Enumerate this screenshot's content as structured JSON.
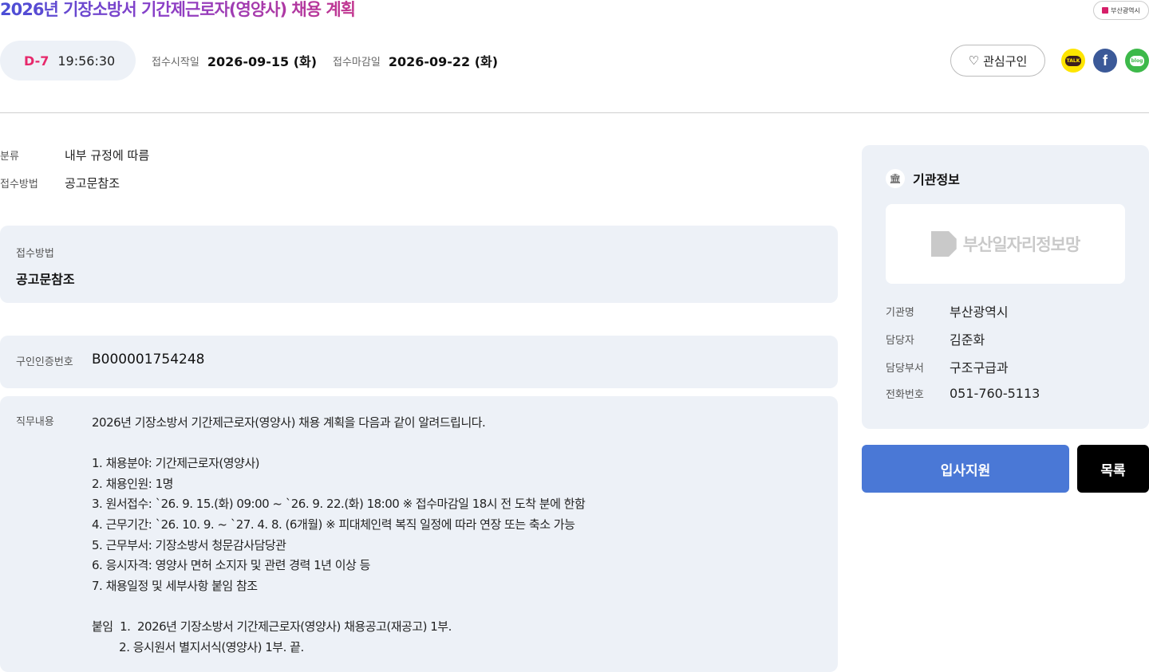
{
  "header": {
    "title": "2026년 기장소방서 기간제근로자(영양사) 채용 계획",
    "org_badge": "부산광역시",
    "dday": "D-7",
    "countdown": "19:56:30",
    "start_label": "접수시작일",
    "start_value": "2026-09-15 (화)",
    "end_label": "접수마감일",
    "end_value": "2026-09-22 (화)",
    "favorite_label": "관심구인",
    "share": {
      "kakao": "TALK",
      "facebook": "f",
      "blog": "blog"
    }
  },
  "summary": [
    {
      "label": "분류",
      "value": "내부 규정에 따름"
    },
    {
      "label": "접수방법",
      "value": "공고문참조"
    }
  ],
  "method_box": {
    "label": "접수방법",
    "value": "공고문참조"
  },
  "cert_box": {
    "label": "구인인증번호",
    "value": "B000001754248"
  },
  "job_box": {
    "label": "직무내용",
    "lines": [
      "2026년 기장소방서 기간제근로자(영양사) 채용 계획을 다음과 같이 알려드립니다.",
      "",
      "1. 채용분야: 기간제근로자(영양사)",
      "2. 채용인원: 1명",
      "3. 원서접수: `26. 9. 15.(화) 09:00 ~ `26. 9. 22.(화) 18:00 ※ 접수마감일 18시 전 도착 분에 한함",
      "4. 근무기간: `26. 10. 9. ~ `27. 4. 8. (6개월) ※ 피대체인력 복직 일정에 따라 연장 또는 축소 가능",
      "5. 근무부서: 기장소방서 청문감사담당관",
      "6. 응시자격: 영양사 면허 소지자 및 관련 경력 1년 이상 등",
      "7. 채용일정 및 세부사항 붙임 참조",
      "",
      "붙임  1.  2026년 기장소방서 기간제근로자(영양사) 채용공고(재공고) 1부.",
      "        2. 응시원서 별지서식(영양사) 1부. 끝."
    ]
  },
  "sidebar": {
    "title": "기관정보",
    "logo_text": "부산일자리정보망",
    "rows": [
      {
        "label": "기관명",
        "value": "부산광역시"
      },
      {
        "label": "담당자",
        "value": "김준화"
      },
      {
        "label": "담당부서",
        "value": "구조구급과"
      },
      {
        "label": "전화번호",
        "value": "051-760-5113"
      }
    ]
  },
  "actions": {
    "apply": "입사지원",
    "list": "목록"
  },
  "colors": {
    "accent": "#4a78d6",
    "dday": "#e6286b",
    "panel": "#edf1f7"
  }
}
